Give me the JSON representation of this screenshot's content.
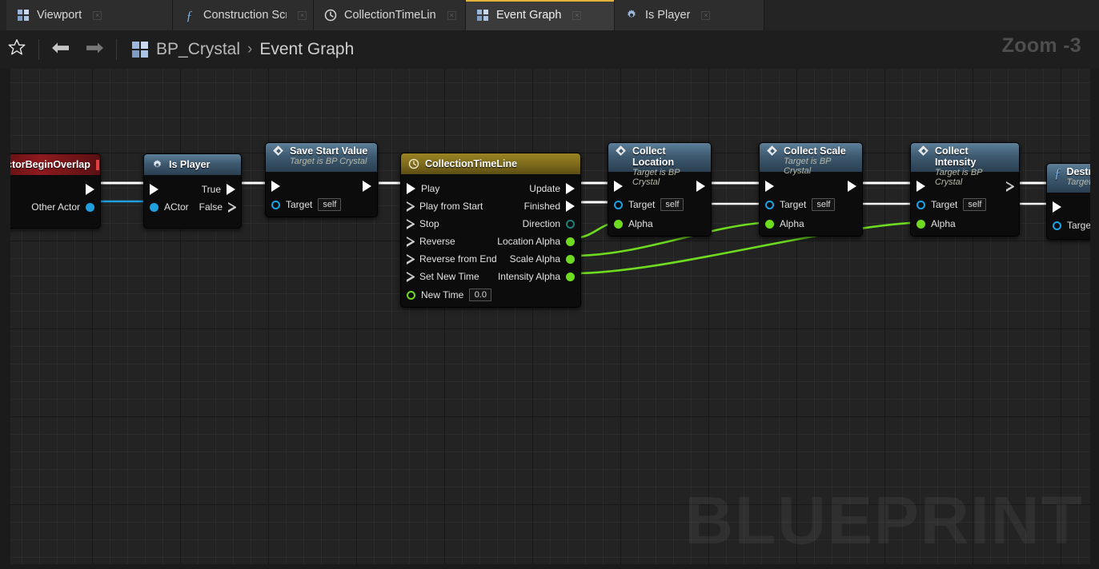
{
  "tabs": [
    {
      "label": "Viewport",
      "icon": "grid-icon",
      "active": false
    },
    {
      "label": "Construction Scrip",
      "icon": "function-icon",
      "active": false
    },
    {
      "label": "CollectionTimeLin",
      "icon": "clock-icon",
      "active": false
    },
    {
      "label": "Event Graph",
      "icon": "grid-icon",
      "active": true
    },
    {
      "label": "Is Player",
      "icon": "gear-icon",
      "active": false
    }
  ],
  "toolbar": {
    "favorite_icon": "star-icon",
    "back_icon": "arrow-left-icon",
    "forward_icon": "arrow-right-icon",
    "blueprint_icon": "grid-icon",
    "breadcrumb_root": "BP_Crystal",
    "breadcrumb_separator": "›",
    "breadcrumb_current": "Event Graph",
    "zoom_label": "Zoom -3"
  },
  "canvas": {
    "watermark": "BLUEPRINT",
    "accent_color": "#e3b23c",
    "exec_wire_color": "#ffffff",
    "data_wire_color": "#6fdb20",
    "object_wire_color": "#1f9fe0"
  },
  "nodes": {
    "actor_begin_overlap": {
      "title": "ctorBeginOverlap",
      "header_color": "#8d1a1e",
      "pins_out": [
        {
          "label": "",
          "type": "exec"
        },
        {
          "label": "Other Actor",
          "type": "object"
        }
      ]
    },
    "is_player": {
      "title": "Is Player",
      "icon": "gear-icon",
      "header_color": "#3e5a70",
      "pins_in": [
        {
          "label": "",
          "type": "exec"
        },
        {
          "label": "ACtor",
          "type": "object"
        }
      ],
      "pins_out": [
        {
          "label": "True",
          "type": "exec"
        },
        {
          "label": "False",
          "type": "exec"
        }
      ]
    },
    "save_start_value": {
      "title": "Save Start Value",
      "subtitle": "Target is BP Crystal",
      "icon": "diamond-icon",
      "header_color": "#3e5a70",
      "pins_in": [
        {
          "label": "",
          "type": "exec"
        },
        {
          "label": "Target",
          "type": "object",
          "value": "self"
        }
      ],
      "pins_out": [
        {
          "label": "",
          "type": "exec"
        }
      ]
    },
    "collection_timeline": {
      "title": "CollectionTimeLine",
      "icon": "clock-icon",
      "header_color": "#7f6c1c",
      "pins_in": [
        {
          "label": "Play",
          "type": "exec",
          "connected": true
        },
        {
          "label": "Play from Start",
          "type": "exec",
          "connected": false
        },
        {
          "label": "Stop",
          "type": "exec",
          "connected": false
        },
        {
          "label": "Reverse",
          "type": "exec",
          "connected": false
        },
        {
          "label": "Reverse from End",
          "type": "exec",
          "connected": false
        },
        {
          "label": "Set New Time",
          "type": "exec",
          "connected": false
        },
        {
          "label": "New Time",
          "type": "float",
          "value": "0.0"
        }
      ],
      "pins_out": [
        {
          "label": "Update",
          "type": "exec",
          "connected": true
        },
        {
          "label": "Finished",
          "type": "exec",
          "connected": true
        },
        {
          "label": "Direction",
          "type": "enum",
          "connected": false
        },
        {
          "label": "Location Alpha",
          "type": "float",
          "connected": true
        },
        {
          "label": "Scale Alpha",
          "type": "float",
          "connected": true
        },
        {
          "label": "Intensity Alpha",
          "type": "float",
          "connected": true
        }
      ]
    },
    "collect_location": {
      "title": "Collect Location",
      "subtitle": "Target is BP Crystal",
      "icon": "diamond-icon",
      "header_color": "#3e5a70",
      "pins_in": [
        {
          "label": "",
          "type": "exec"
        },
        {
          "label": "Target",
          "type": "object",
          "value": "self"
        },
        {
          "label": "Alpha",
          "type": "float"
        }
      ],
      "pins_out": [
        {
          "label": "",
          "type": "exec"
        }
      ]
    },
    "collect_scale": {
      "title": "Collect Scale",
      "subtitle": "Target is BP Crystal",
      "icon": "diamond-icon",
      "header_color": "#3e5a70",
      "pins_in": [
        {
          "label": "",
          "type": "exec"
        },
        {
          "label": "Target",
          "type": "object",
          "value": "self"
        },
        {
          "label": "Alpha",
          "type": "float"
        }
      ],
      "pins_out": [
        {
          "label": "",
          "type": "exec"
        }
      ]
    },
    "collect_intensity": {
      "title": "Collect Intensity",
      "subtitle": "Target is BP Crystal",
      "icon": "diamond-icon",
      "header_color": "#3e5a70",
      "pins_in": [
        {
          "label": "",
          "type": "exec"
        },
        {
          "label": "Target",
          "type": "object",
          "value": "self"
        },
        {
          "label": "Alpha",
          "type": "float"
        }
      ],
      "pins_out": [
        {
          "label": "",
          "type": "exec",
          "connected": false
        }
      ]
    },
    "destroy_actor": {
      "title": "Destroy",
      "subtitle": "Target is",
      "icon": "function-icon",
      "header_color": "#3e5a70",
      "pins_in": [
        {
          "label": "",
          "type": "exec"
        },
        {
          "label": "Target",
          "type": "object"
        }
      ]
    }
  }
}
